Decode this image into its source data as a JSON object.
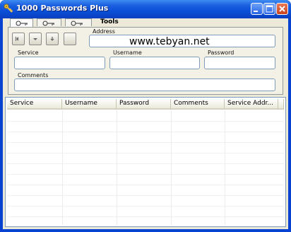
{
  "window": {
    "title": "1000 Passwords Plus",
    "colors": {
      "titlebar": "#0b4fd8",
      "face": "#ece9d8",
      "field_border": "#7f9db9"
    }
  },
  "titlebar_buttons": [
    {
      "name": "minimize-icon"
    },
    {
      "name": "maximize-icon"
    },
    {
      "name": "close-icon"
    }
  ],
  "tabs": [
    {
      "icon": "key-icon",
      "active": true
    },
    {
      "icon": "key-icon",
      "active": false
    },
    {
      "icon": "key-icon",
      "active": false
    }
  ],
  "tools_label": "Tools",
  "nav_buttons": [
    "first-record-icon",
    "previous-record-icon",
    "next-record-icon",
    "last-record-icon"
  ],
  "form": {
    "address_label": "Address",
    "address_value": "www.tebyan.net",
    "service_label": "Service",
    "service_value": "",
    "username_label": "Username",
    "username_value": "",
    "password_label": "Password",
    "password_value": "",
    "comments_label": "Comments",
    "comments_value": ""
  },
  "table": {
    "columns": [
      "Service",
      "Username",
      "Password",
      "Comments",
      "Service Addr..."
    ],
    "rows": []
  }
}
